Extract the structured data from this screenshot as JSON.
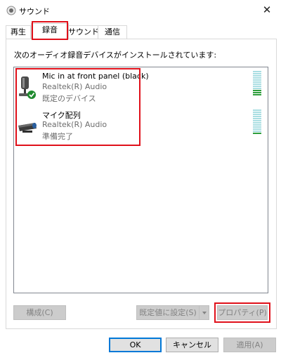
{
  "window": {
    "title": "サウンド",
    "close_glyph": "✕"
  },
  "tabs": [
    {
      "label": "再生",
      "active": false
    },
    {
      "label": "録音",
      "active": true
    },
    {
      "label": "サウンド",
      "active": false
    },
    {
      "label": "通信",
      "active": false
    }
  ],
  "instruction": "次のオーディオ録音デバイスがインストールされています:",
  "devices": [
    {
      "name": "Mic in at front panel (black)",
      "driver": "Realtek(R) Audio",
      "state": "既定のデバイス",
      "icon": "microphone-icon",
      "default_badge": "check-icon",
      "level_active_bars": 3
    },
    {
      "name": "マイク配列",
      "driver": "Realtek(R) Audio",
      "state": "準備完了",
      "icon": "mic-array-icon",
      "level_active_bars": 1
    }
  ],
  "buttons": {
    "configure": "構成(C)",
    "set_default": "既定値に設定(S)",
    "properties": "プロパティ(P)",
    "ok": "OK",
    "cancel": "キャンセル",
    "apply": "適用(A)"
  },
  "colors": {
    "highlight_red": "#e0101a",
    "meter_inactive": "#a9dee2",
    "meter_active": "#2e9e3c",
    "default_check": "#1f8a2e"
  }
}
